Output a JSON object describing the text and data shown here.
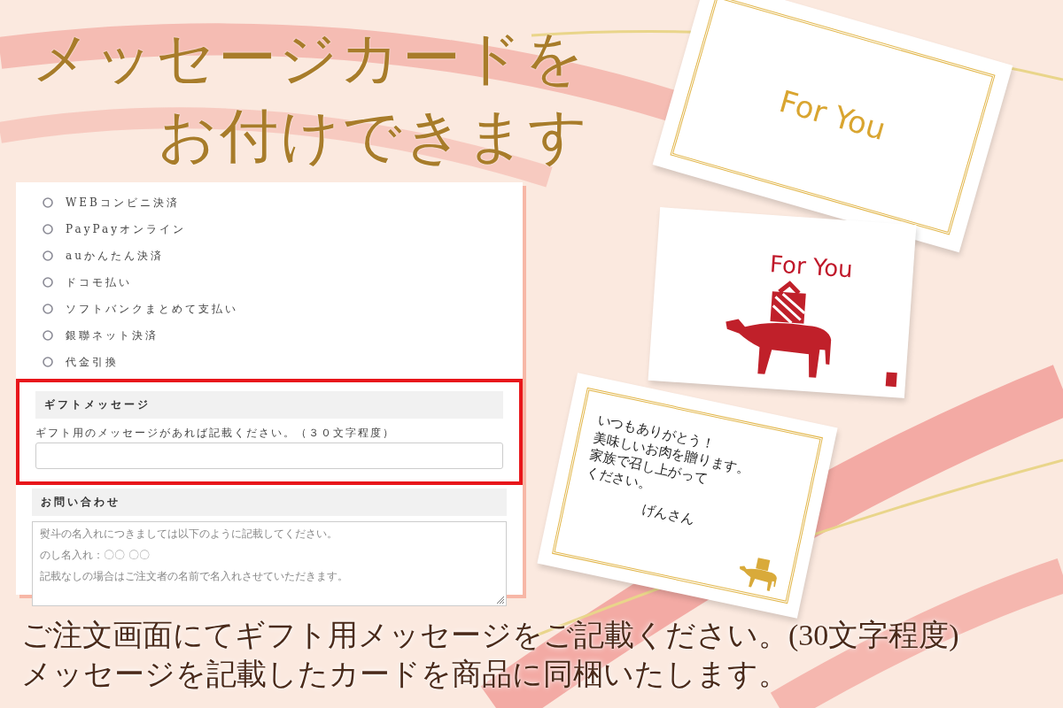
{
  "headline": [
    "メッセージカードを",
    "お付けできます"
  ],
  "form": {
    "payment_options": [
      {
        "label": "WEBコンビニ決済",
        "selected": false
      },
      {
        "label": "PayPayオンライン",
        "selected": false
      },
      {
        "label": "auかんたん決済",
        "selected": false
      },
      {
        "label": "ドコモ払い",
        "selected": false
      },
      {
        "label": "ソフトバンクまとめて支払い",
        "selected": false
      },
      {
        "label": "銀聯ネット決済",
        "selected": false
      },
      {
        "label": "代金引換",
        "selected": false
      }
    ],
    "gift_message": {
      "highlighted": true,
      "heading": "ギフトメッセージ",
      "label": "ギフト用のメッセージがあれば記載ください。（３０文字程度）"
    },
    "inquiry": {
      "heading": "お問い合わせ",
      "placeholder": [
        "熨斗の名入れにつきましては以下のように記載してください。",
        "のし名入れ：〇〇 〇〇",
        "記載なしの場合はご注文者の名前で名入れさせていただきます。"
      ]
    }
  },
  "cards": {
    "front_title": "For You",
    "inside_title": "For You",
    "message_lines": [
      "いつもありがとう！",
      "美味しいお肉を贈ります。",
      "家族で召し上がって",
      "ください。"
    ],
    "signature": "げんさん"
  },
  "caption": [
    "ご注文画面にてギフト用メッセージをご記載ください。(30文字程度)",
    "メッセージを記載したカードを商品に同梱いたします。"
  ]
}
